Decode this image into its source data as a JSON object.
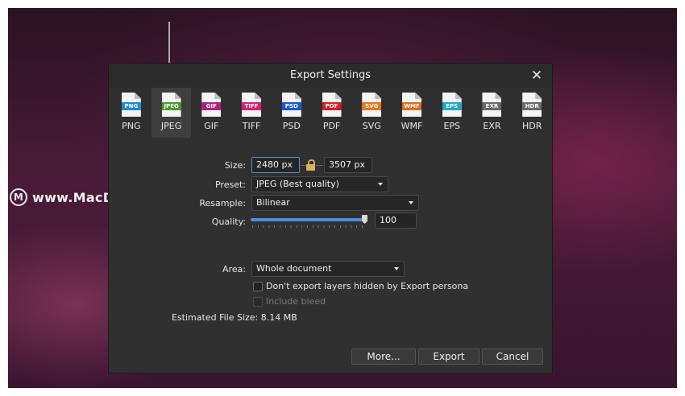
{
  "watermark": {
    "text": "www.MacDown.com",
    "logo_letter": "M"
  },
  "dialog": {
    "title": "Export Settings",
    "close_glyph": "✕"
  },
  "formats": [
    {
      "label": "PNG",
      "badge": "PNG",
      "color": "#1e8bd6",
      "selected": false
    },
    {
      "label": "JPEG",
      "badge": "JPEG",
      "color": "#4a9b2a",
      "selected": true
    },
    {
      "label": "GIF",
      "badge": "GIF",
      "color": "#b0217e",
      "selected": false
    },
    {
      "label": "TIFF",
      "badge": "TIFF",
      "color": "#d91d6e",
      "selected": false
    },
    {
      "label": "PSD",
      "badge": "PSD",
      "color": "#1558d6",
      "selected": false
    },
    {
      "label": "PDF",
      "badge": "PDF",
      "color": "#d81e1e",
      "selected": false
    },
    {
      "label": "SVG",
      "badge": "SVG",
      "color": "#e9761a",
      "selected": false
    },
    {
      "label": "WMF",
      "badge": "WMF",
      "color": "#e36a1a",
      "selected": false
    },
    {
      "label": "EPS",
      "badge": "EPS",
      "color": "#20a8c8",
      "selected": false
    },
    {
      "label": "EXR",
      "badge": "EXR",
      "color": "#6a6a6a",
      "selected": false
    },
    {
      "label": "HDR",
      "badge": "HDR",
      "color": "#6a6a6a",
      "selected": false
    }
  ],
  "settings": {
    "size_label": "Size:",
    "width_value": "2480 px",
    "height_value": "3507 px",
    "preset_label": "Preset:",
    "preset_value": "JPEG (Best quality)",
    "resample_label": "Resample:",
    "resample_value": "Bilinear",
    "quality_label": "Quality:",
    "quality_value": "100",
    "quality_fraction": 1.0,
    "area_label": "Area:",
    "area_value": "Whole document",
    "hidden_layers_label": "Don't export layers hidden by Export persona",
    "include_bleed_label": "Include bleed",
    "estimated_size": "Estimated File Size: 8.14 MB"
  },
  "buttons": {
    "more": "More...",
    "export": "Export",
    "cancel": "Cancel"
  },
  "colors": {
    "accent": "#4a8fd8",
    "dialog_bg": "#303030"
  }
}
